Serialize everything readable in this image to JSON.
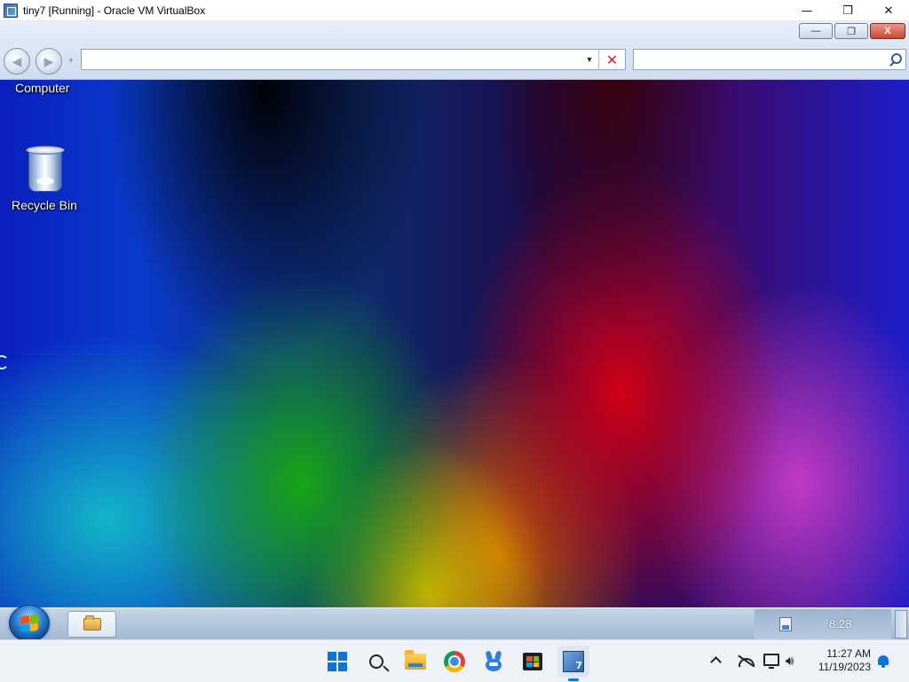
{
  "host_window": {
    "title": "tiny7 [Running] - Oracle VM VirtualBox",
    "controls": {
      "minimize": "—",
      "restore": "❐",
      "close": "✕"
    }
  },
  "guest": {
    "explorer": {
      "window_buttons": {
        "minimize": "—",
        "restore": "❐",
        "close": "X"
      },
      "back_icon": "back-arrow-icon",
      "forward_icon": "forward-arrow-icon",
      "address": {
        "value": "",
        "placeholder": ""
      },
      "search": {
        "value": "",
        "placeholder": ""
      }
    },
    "desktop": {
      "icons": [
        {
          "label": "Computer",
          "icon": "computer-icon"
        },
        {
          "label": "Recycle Bin",
          "icon": "recycle-bin-icon"
        }
      ]
    },
    "taskbar": {
      "start": "windows-7-start-orb",
      "pinned": [
        "windows-explorer"
      ],
      "clock": "8:28"
    }
  },
  "host_taskbar": {
    "items": [
      "start",
      "search",
      "file-explorer",
      "chrome",
      "rabbit-app",
      "microsoft-store",
      "virtualbox"
    ],
    "clock": {
      "time": "11:27 AM",
      "date": "11/19/2023"
    }
  },
  "colors": {
    "win11_accent": "#0a74d8",
    "stop_red": "#d62020",
    "guest_taskbar": "#b3c6dd"
  }
}
